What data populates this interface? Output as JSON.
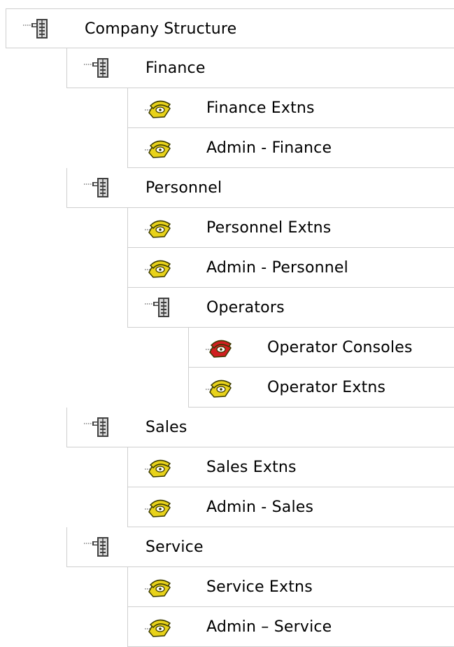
{
  "tree": {
    "nodes": [
      {
        "label": "Company Structure",
        "icon": "group-folder-icon",
        "level": 0
      },
      {
        "label": "Finance",
        "icon": "group-folder-icon",
        "level": 1
      },
      {
        "label": "Finance Extns",
        "icon": "telephone-icon",
        "level": 2
      },
      {
        "label": "Admin - Finance",
        "icon": "telephone-icon",
        "level": 2
      },
      {
        "label": "Personnel",
        "icon": "group-folder-icon",
        "level": 1
      },
      {
        "label": "Personnel Extns",
        "icon": "telephone-icon",
        "level": 2
      },
      {
        "label": "Admin - Personnel",
        "icon": "telephone-icon",
        "level": 2
      },
      {
        "label": "Operators",
        "icon": "group-folder-icon",
        "level": 2
      },
      {
        "label": "Operator Consoles",
        "icon": "red-telephone-icon",
        "level": 3
      },
      {
        "label": "Operator Extns",
        "icon": "telephone-icon",
        "level": 3
      },
      {
        "label": "Sales",
        "icon": "group-folder-icon",
        "level": 1
      },
      {
        "label": "Sales Extns",
        "icon": "telephone-icon",
        "level": 2
      },
      {
        "label": "Admin - Sales",
        "icon": "telephone-icon",
        "level": 2
      },
      {
        "label": "Service",
        "icon": "group-folder-icon",
        "level": 1
      },
      {
        "label": "Service Extns",
        "icon": "telephone-icon",
        "level": 2
      },
      {
        "label": "Admin – Service",
        "icon": "telephone-icon",
        "level": 2
      }
    ]
  },
  "colors": {
    "phone_yellow": "#e8d21a",
    "phone_red": "#d02020",
    "grid_line": "#cfcfcf",
    "folder_dark": "#404040"
  }
}
